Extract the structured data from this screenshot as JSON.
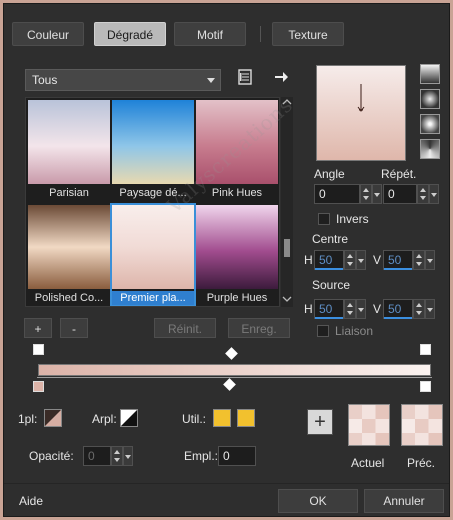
{
  "tabs": [
    {
      "label": "Couleur",
      "active": false
    },
    {
      "label": "Dégradé",
      "active": true
    },
    {
      "label": "Motif",
      "active": false
    },
    {
      "label": "Texture",
      "active": false
    }
  ],
  "category_dropdown": {
    "value": "Tous"
  },
  "gradients": [
    {
      "name": "Parisian",
      "colors": [
        "#b9c3d9",
        "#f3e5ea",
        "#c99aaa"
      ]
    },
    {
      "name": "Paysage dé...",
      "colors": [
        "#1f82d8",
        "#8fc6e8",
        "#e8d9b0"
      ]
    },
    {
      "name": "Pink Hues",
      "colors": [
        "#e3c1c8",
        "#c77c8e",
        "#a9506c"
      ]
    },
    {
      "name": "Polished Co...",
      "colors": [
        "#6b4a36",
        "#f1d9c4",
        "#8a5d3e"
      ]
    },
    {
      "name": "Premier pla...",
      "colors": [
        "#f8eeec",
        "#f1dbd6",
        "#ddb5aa"
      ],
      "selected": true
    },
    {
      "name": "Purple Hues",
      "colors": [
        "#f0d5ec",
        "#a14c8e",
        "#3c1b3c"
      ]
    }
  ],
  "buttons": {
    "add": "+",
    "remove": "-",
    "reset": "Réinit.",
    "save": "Enreg.",
    "ok": "OK",
    "cancel": "Annuler",
    "help": "Aide",
    "add_to_swatches": "+"
  },
  "angle": {
    "label": "Angle",
    "value": "0"
  },
  "repeats": {
    "label": "Répét.",
    "value": "0"
  },
  "invert": {
    "label": "Invers",
    "checked": false
  },
  "center": {
    "label": "Centre",
    "h_label": "H",
    "h_value": "50",
    "v_label": "V",
    "v_value": "50"
  },
  "source": {
    "label": "Source",
    "h_label": "H",
    "h_value": "50",
    "v_label": "V",
    "v_value": "50"
  },
  "link": {
    "label": "Liaison",
    "checked": false
  },
  "stop_row": {
    "fg_label": "1pl:",
    "bg_label": "Arpl:",
    "user_label": "Util.:",
    "user_color": "#f2c12e",
    "opacity_label": "Opacité:",
    "opacity_value": "0",
    "location_label": "Empl.:",
    "location_value": "0"
  },
  "previews": {
    "current_label": "Actuel",
    "previous_label": "Préc."
  },
  "watermark": "Valyscreations"
}
